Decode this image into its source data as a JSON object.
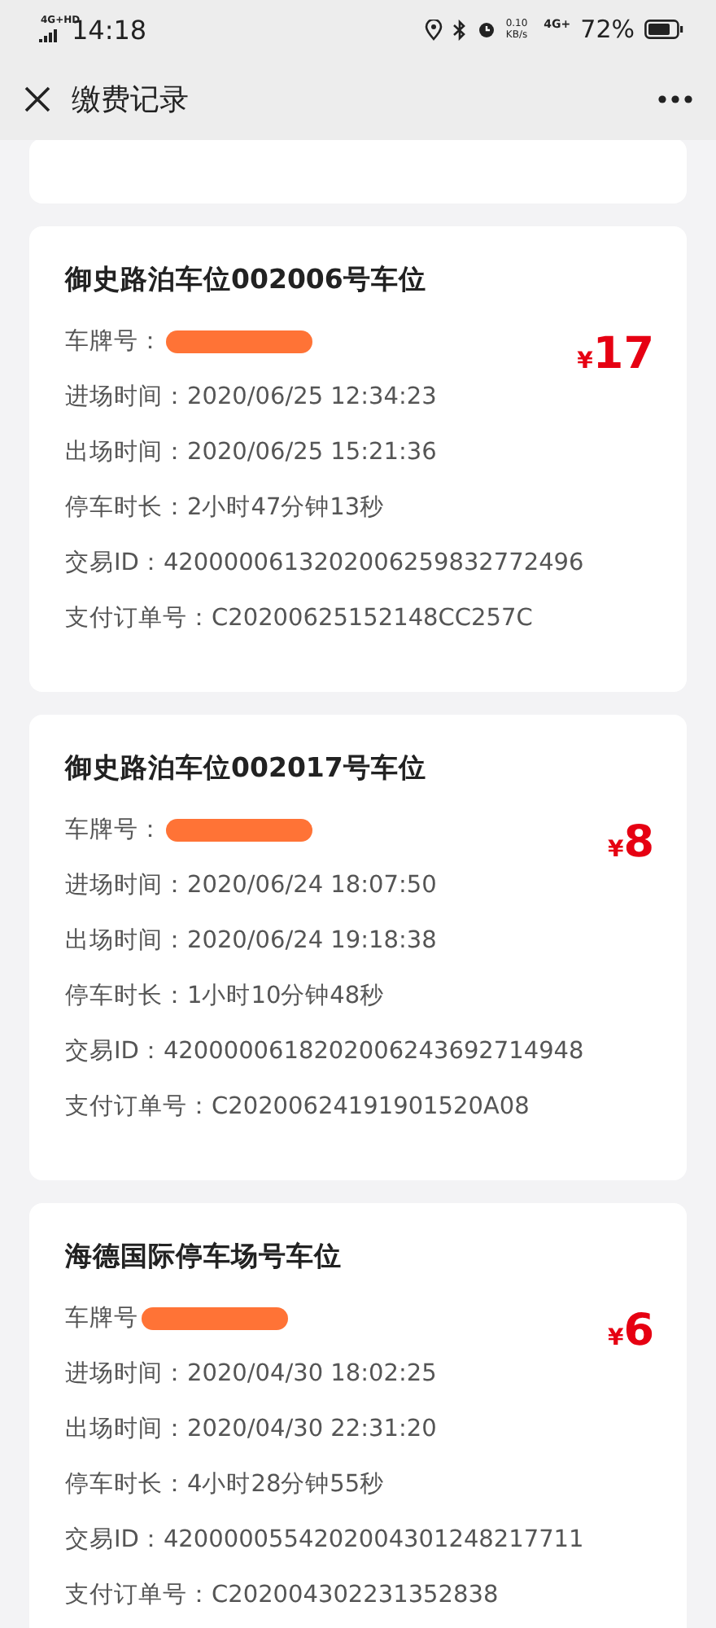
{
  "status_bar": {
    "network": "4G+HD",
    "time": "14:18",
    "speed": "0.10",
    "speed_unit": "KB/s",
    "mobile": "4G+",
    "battery": "72%"
  },
  "header": {
    "title": "缴费记录"
  },
  "records": [
    {
      "title": "御史路泊车位002006号车位",
      "amount_symbol": "¥",
      "amount": "17",
      "fields": [
        {
          "kind": "plate",
          "label": "车牌号："
        },
        {
          "kind": "text",
          "label": "进场时间：",
          "value": "2020/06/25 12:34:23"
        },
        {
          "kind": "text",
          "label": "出场时间：",
          "value": "2020/06/25 15:21:36"
        },
        {
          "kind": "text",
          "label": "停车时长：",
          "value": "2小时47分钟13秒"
        },
        {
          "kind": "text",
          "label": "交易ID：",
          "value": "4200000613202006259832772496"
        },
        {
          "kind": "text",
          "label": "支付订单号：",
          "value": "C20200625152148CC257C"
        }
      ]
    },
    {
      "title": "御史路泊车位002017号车位",
      "amount_symbol": "¥",
      "amount": "8",
      "fields": [
        {
          "kind": "plate",
          "label": "车牌号："
        },
        {
          "kind": "text",
          "label": "进场时间：",
          "value": "2020/06/24 18:07:50"
        },
        {
          "kind": "text",
          "label": "出场时间：",
          "value": "2020/06/24 19:18:38"
        },
        {
          "kind": "text",
          "label": "停车时长：",
          "value": "1小时10分钟48秒"
        },
        {
          "kind": "text",
          "label": "交易ID：",
          "value": "4200000618202006243692714948"
        },
        {
          "kind": "text",
          "label": "支付订单号：",
          "value": "C20200624191901520A08"
        }
      ]
    },
    {
      "title": "海德国际停车场号车位",
      "amount_symbol": "¥",
      "amount": "6",
      "fields": [
        {
          "kind": "plate",
          "label": "车牌号"
        },
        {
          "kind": "text",
          "label": "进场时间：",
          "value": "2020/04/30 18:02:25"
        },
        {
          "kind": "text",
          "label": "出场时间：",
          "value": "2020/04/30 22:31:20"
        },
        {
          "kind": "text",
          "label": "停车时长：",
          "value": "4小时28分钟55秒"
        },
        {
          "kind": "text",
          "label": "交易ID：",
          "value": "4200000554202004301248217711"
        },
        {
          "kind": "text",
          "label": "支付订单号：",
          "value": "C202004302231352838"
        }
      ]
    }
  ]
}
